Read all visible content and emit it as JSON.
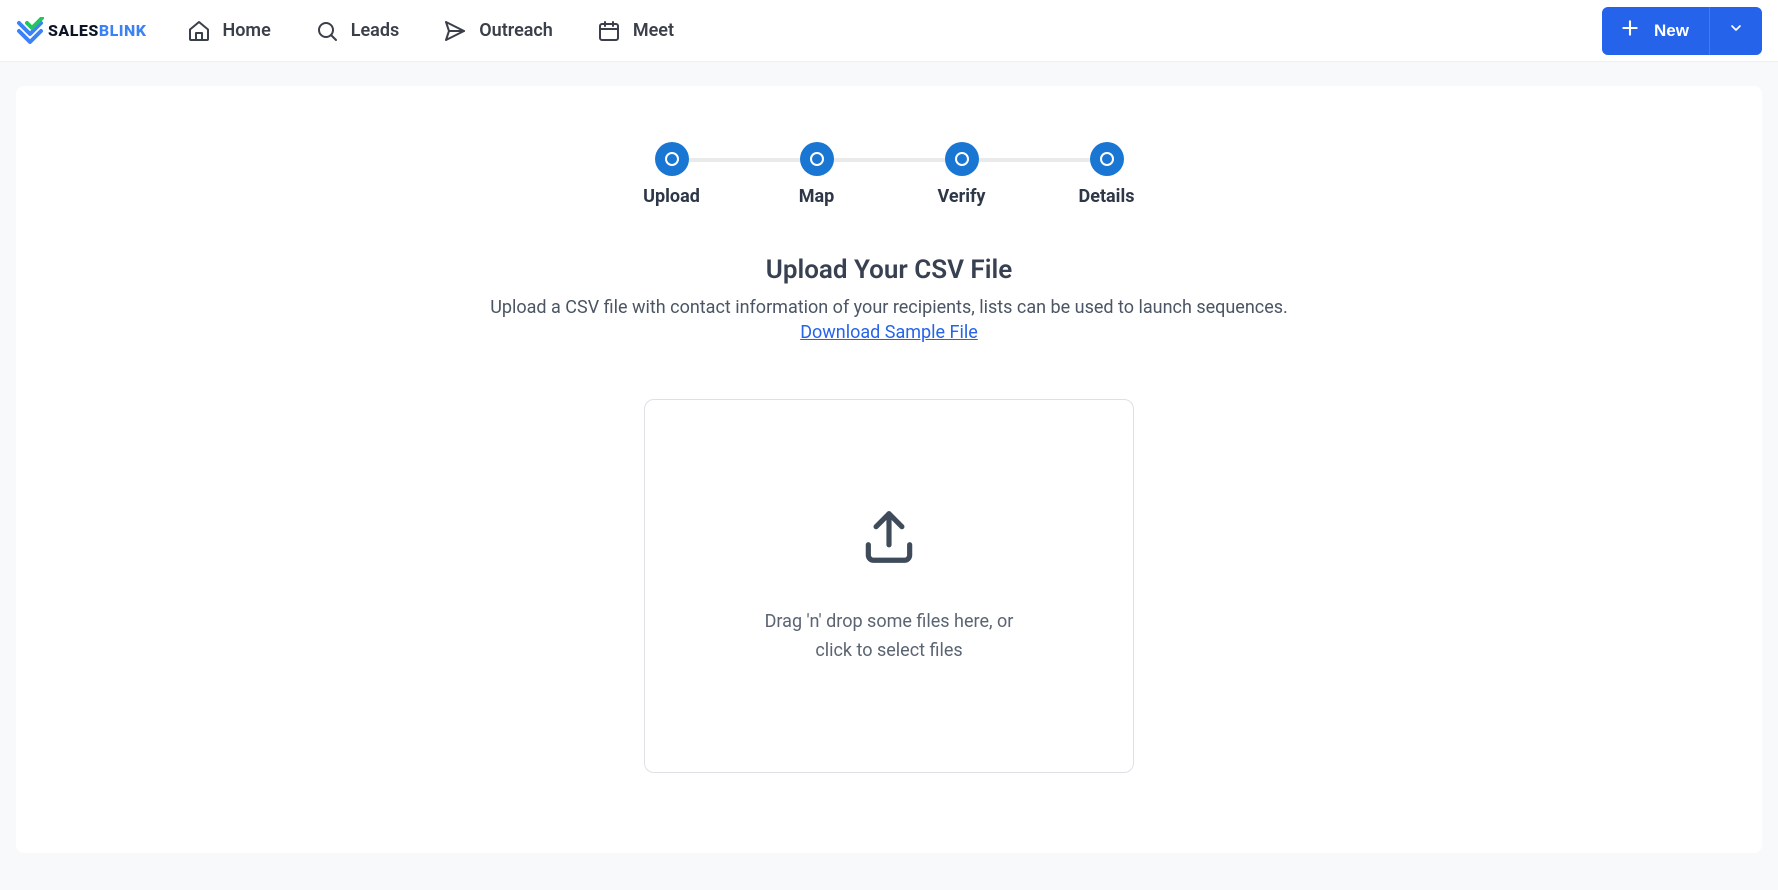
{
  "brand": {
    "name_part1": "SALES",
    "name_part2": "BLINK"
  },
  "nav": {
    "home": "Home",
    "leads": "Leads",
    "outreach": "Outreach",
    "meet": "Meet"
  },
  "newButton": {
    "label": "New"
  },
  "stepper": {
    "steps": [
      "Upload",
      "Map",
      "Verify",
      "Details"
    ]
  },
  "page": {
    "heading": "Upload Your CSV File",
    "subheading": "Upload a CSV file with contact information of your recipients, lists can be used to launch sequences.",
    "downloadLink": "Download Sample File",
    "dropText1": "Drag 'n' drop some files here, or",
    "dropText2": "click to select files"
  }
}
